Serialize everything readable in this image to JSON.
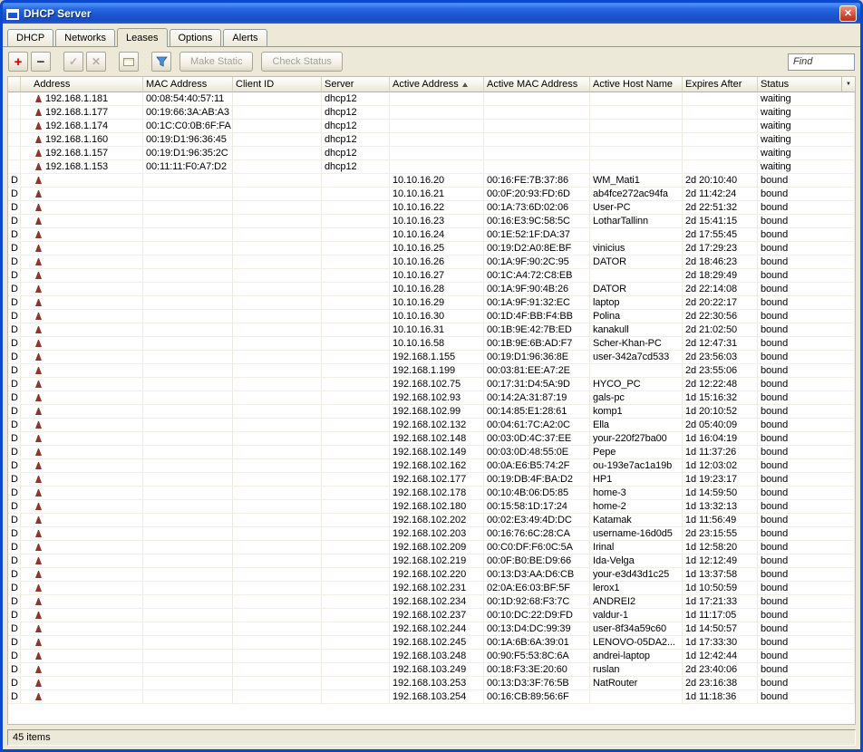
{
  "window": {
    "title": "DHCP Server"
  },
  "icons": {
    "close": "✕",
    "add": "+",
    "remove": "−",
    "enable": "✓",
    "disable": "✕",
    "comment": "note-shape",
    "filter": "funnel-shape",
    "dropdown": "▼",
    "sort": "ascending-triangle",
    "lease": "red-cone"
  },
  "tabs": [
    {
      "label": "DHCP",
      "active": false
    },
    {
      "label": "Networks",
      "active": false
    },
    {
      "label": "Leases",
      "active": true
    },
    {
      "label": "Options",
      "active": false
    },
    {
      "label": "Alerts",
      "active": false
    }
  ],
  "toolbar": {
    "make_static": "Make Static",
    "check_status": "Check Status",
    "find_label": "Find"
  },
  "table": {
    "columns": [
      "Address",
      "MAC Address",
      "Client ID",
      "Server",
      "Active Address",
      "Active MAC Address",
      "Active Host Name",
      "Expires After",
      "Status"
    ],
    "sorted_column": "Active Address",
    "rows": [
      {
        "address": "192.168.1.181",
        "mac": "00:08:54:40:57:11",
        "server": "dhcp12",
        "status": "waiting"
      },
      {
        "address": "192.168.1.177",
        "mac": "00:19:66:3A:AB:A3",
        "server": "dhcp12",
        "status": "waiting"
      },
      {
        "address": "192.168.1.174",
        "mac": "00:1C:C0:0B:6F:FA",
        "server": "dhcp12",
        "status": "waiting"
      },
      {
        "address": "192.168.1.160",
        "mac": "00:19:D1:96:36:45",
        "server": "dhcp12",
        "status": "waiting"
      },
      {
        "address": "192.168.1.157",
        "mac": "00:19:D1:96:35:2C",
        "server": "dhcp12",
        "status": "waiting"
      },
      {
        "address": "192.168.1.153",
        "mac": "00:11:11:F0:A7:D2",
        "server": "dhcp12",
        "status": "waiting"
      },
      {
        "flag": "D",
        "aaddr": "10.10.16.20",
        "amac": "00:16:FE:7B:37:86",
        "ahost": "WM_Mati1",
        "expires": "2d 20:10:40",
        "status": "bound"
      },
      {
        "flag": "D",
        "aaddr": "10.10.16.21",
        "amac": "00:0F:20:93:FD:6D",
        "ahost": "ab4fce272ac94fa",
        "expires": "2d 11:42:24",
        "status": "bound"
      },
      {
        "flag": "D",
        "aaddr": "10.10.16.22",
        "amac": "00:1A:73:6D:02:06",
        "ahost": "User-PC",
        "expires": "2d 22:51:32",
        "status": "bound"
      },
      {
        "flag": "D",
        "aaddr": "10.10.16.23",
        "amac": "00:16:E3:9C:58:5C",
        "ahost": "LotharTallinn",
        "expires": "2d 15:41:15",
        "status": "bound"
      },
      {
        "flag": "D",
        "aaddr": "10.10.16.24",
        "amac": "00:1E:52:1F:DA:37",
        "ahost": "",
        "expires": "2d 17:55:45",
        "status": "bound"
      },
      {
        "flag": "D",
        "aaddr": "10.10.16.25",
        "amac": "00:19:D2:A0:8E:BF",
        "ahost": "vinicius",
        "expires": "2d 17:29:23",
        "status": "bound"
      },
      {
        "flag": "D",
        "aaddr": "10.10.16.26",
        "amac": "00:1A:9F:90:2C:95",
        "ahost": "DATOR",
        "expires": "2d 18:46:23",
        "status": "bound"
      },
      {
        "flag": "D",
        "aaddr": "10.10.16.27",
        "amac": "00:1C:A4:72:C8:EB",
        "ahost": "",
        "expires": "2d 18:29:49",
        "status": "bound"
      },
      {
        "flag": "D",
        "aaddr": "10.10.16.28",
        "amac": "00:1A:9F:90:4B:26",
        "ahost": "DATOR",
        "expires": "2d 22:14:08",
        "status": "bound"
      },
      {
        "flag": "D",
        "aaddr": "10.10.16.29",
        "amac": "00:1A:9F:91:32:EC",
        "ahost": "laptop",
        "expires": "2d 20:22:17",
        "status": "bound"
      },
      {
        "flag": "D",
        "aaddr": "10.10.16.30",
        "amac": "00:1D:4F:BB:F4:BB",
        "ahost": "Polina",
        "expires": "2d 22:30:56",
        "status": "bound"
      },
      {
        "flag": "D",
        "aaddr": "10.10.16.31",
        "amac": "00:1B:9E:42:7B:ED",
        "ahost": "kanakull",
        "expires": "2d 21:02:50",
        "status": "bound"
      },
      {
        "flag": "D",
        "aaddr": "10.10.16.58",
        "amac": "00:1B:9E:6B:AD:F7",
        "ahost": "Scher-Khan-PC",
        "expires": "2d 12:47:31",
        "status": "bound"
      },
      {
        "flag": "D",
        "aaddr": "192.168.1.155",
        "amac": "00:19:D1:96:36:8E",
        "ahost": "user-342a7cd533",
        "expires": "2d 23:56:03",
        "status": "bound"
      },
      {
        "flag": "D",
        "aaddr": "192.168.1.199",
        "amac": "00:03:81:EE:A7:2E",
        "ahost": "",
        "expires": "2d 23:55:06",
        "status": "bound"
      },
      {
        "flag": "D",
        "aaddr": "192.168.102.75",
        "amac": "00:17:31:D4:5A:9D",
        "ahost": "HYCO_PC",
        "expires": "2d 12:22:48",
        "status": "bound"
      },
      {
        "flag": "D",
        "aaddr": "192.168.102.93",
        "amac": "00:14:2A:31:87:19",
        "ahost": "gals-pc",
        "expires": "1d 15:16:32",
        "status": "bound"
      },
      {
        "flag": "D",
        "aaddr": "192.168.102.99",
        "amac": "00:14:85:E1:28:61",
        "ahost": "komp1",
        "expires": "1d 20:10:52",
        "status": "bound"
      },
      {
        "flag": "D",
        "aaddr": "192.168.102.132",
        "amac": "00:04:61:7C:A2:0C",
        "ahost": "Ella",
        "expires": "2d 05:40:09",
        "status": "bound"
      },
      {
        "flag": "D",
        "aaddr": "192.168.102.148",
        "amac": "00:03:0D:4C:37:EE",
        "ahost": "your-220f27ba00",
        "expires": "1d 16:04:19",
        "status": "bound"
      },
      {
        "flag": "D",
        "aaddr": "192.168.102.149",
        "amac": "00:03:0D:48:55:0E",
        "ahost": "Pepe",
        "expires": "1d 11:37:26",
        "status": "bound"
      },
      {
        "flag": "D",
        "aaddr": "192.168.102.162",
        "amac": "00:0A:E6:B5:74:2F",
        "ahost": "ou-193e7ac1a19b",
        "expires": "1d 12:03:02",
        "status": "bound"
      },
      {
        "flag": "D",
        "aaddr": "192.168.102.177",
        "amac": "00:19:DB:4F:BA:D2",
        "ahost": "HP1",
        "expires": "1d 19:23:17",
        "status": "bound"
      },
      {
        "flag": "D",
        "aaddr": "192.168.102.178",
        "amac": "00:10:4B:06:D5:85",
        "ahost": "home-3",
        "expires": "1d 14:59:50",
        "status": "bound"
      },
      {
        "flag": "D",
        "aaddr": "192.168.102.180",
        "amac": "00:15:58:1D:17:24",
        "ahost": "home-2",
        "expires": "1d 13:32:13",
        "status": "bound"
      },
      {
        "flag": "D",
        "aaddr": "192.168.102.202",
        "amac": "00:02:E3:49:4D:DC",
        "ahost": "Katamak",
        "expires": "1d 11:56:49",
        "status": "bound"
      },
      {
        "flag": "D",
        "aaddr": "192.168.102.203",
        "amac": "00:16:76:6C:28:CA",
        "ahost": "username-16d0d5",
        "expires": "2d 23:15:55",
        "status": "bound"
      },
      {
        "flag": "D",
        "aaddr": "192.168.102.209",
        "amac": "00:C0:DF:F6:0C:5A",
        "ahost": "Irinal",
        "expires": "1d 12:58:20",
        "status": "bound"
      },
      {
        "flag": "D",
        "aaddr": "192.168.102.219",
        "amac": "00:0F:B0:BE:D9:66",
        "ahost": "Ida-Velga",
        "expires": "1d 12:12:49",
        "status": "bound"
      },
      {
        "flag": "D",
        "aaddr": "192.168.102.220",
        "amac": "00:13:D3:AA:D6:CB",
        "ahost": "your-e3d43d1c25",
        "expires": "1d 13:37:58",
        "status": "bound"
      },
      {
        "flag": "D",
        "aaddr": "192.168.102.231",
        "amac": "02:0A:E6:03:BF:5F",
        "ahost": "lerox1",
        "expires": "1d 10:50:59",
        "status": "bound"
      },
      {
        "flag": "D",
        "aaddr": "192.168.102.234",
        "amac": "00:1D:92:68:F3:7C",
        "ahost": "ANDREI2",
        "expires": "1d 17:21:33",
        "status": "bound"
      },
      {
        "flag": "D",
        "aaddr": "192.168.102.237",
        "amac": "00:10:DC:22:D9:FD",
        "ahost": "valdur-1",
        "expires": "1d 11:17:05",
        "status": "bound"
      },
      {
        "flag": "D",
        "aaddr": "192.168.102.244",
        "amac": "00:13:D4:DC:99:39",
        "ahost": "user-8f34a59c60",
        "expires": "1d 14:50:57",
        "status": "bound"
      },
      {
        "flag": "D",
        "aaddr": "192.168.102.245",
        "amac": "00:1A:6B:6A:39:01",
        "ahost": "LENOVO-05DA2...",
        "expires": "1d 17:33:30",
        "status": "bound"
      },
      {
        "flag": "D",
        "aaddr": "192.168.103.248",
        "amac": "00:90:F5:53:8C:6A",
        "ahost": "andrei-laptop",
        "expires": "1d 12:42:44",
        "status": "bound"
      },
      {
        "flag": "D",
        "aaddr": "192.168.103.249",
        "amac": "00:18:F3:3E:20:60",
        "ahost": "ruslan",
        "expires": "2d 23:40:06",
        "status": "bound"
      },
      {
        "flag": "D",
        "aaddr": "192.168.103.253",
        "amac": "00:13:D3:3F:76:5B",
        "ahost": "NatRouter",
        "expires": "2d 23:16:38",
        "status": "bound"
      },
      {
        "flag": "D",
        "aaddr": "192.168.103.254",
        "amac": "00:16:CB:89:56:6F",
        "ahost": "",
        "expires": "1d 11:18:36",
        "status": "bound"
      }
    ]
  },
  "statusbar": {
    "text": "45 items"
  }
}
